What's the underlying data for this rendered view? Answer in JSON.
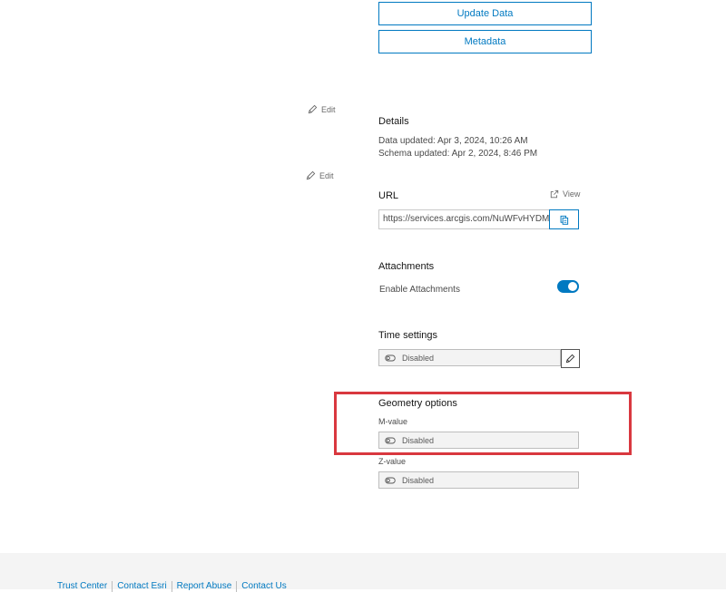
{
  "buttons": {
    "update_data": "Update Data",
    "metadata": "Metadata"
  },
  "edit_links": [
    "Edit",
    "Edit"
  ],
  "details": {
    "title": "Details",
    "data_updated": "Data updated: Apr 3, 2024, 10:26 AM",
    "schema_updated": "Schema updated: Apr 2, 2024, 8:46 PM"
  },
  "url_section": {
    "title": "URL",
    "view_label": "View",
    "value": "https://services.arcgis.com/NuWFvHYDMVmmxMeM/"
  },
  "attachments": {
    "title": "Attachments",
    "enable_label": "Enable Attachments",
    "enabled": true
  },
  "time_settings": {
    "title": "Time settings",
    "status": "Disabled"
  },
  "geometry": {
    "title": "Geometry options",
    "m_label": "M-value",
    "m_status": "Disabled",
    "z_label": "Z-value",
    "z_status": "Disabled"
  },
  "footer": {
    "links": [
      "Trust Center",
      "Contact Esri",
      "Report Abuse",
      "Contact Us"
    ]
  },
  "colors": {
    "accent": "#0079c1",
    "highlight": "#d9383f",
    "footer_bg": "#f4f4f4"
  },
  "icons": {
    "edit": "pencil-icon",
    "view": "external-link-icon",
    "copy": "copy-icon",
    "disabled": "toggle-off-icon"
  }
}
